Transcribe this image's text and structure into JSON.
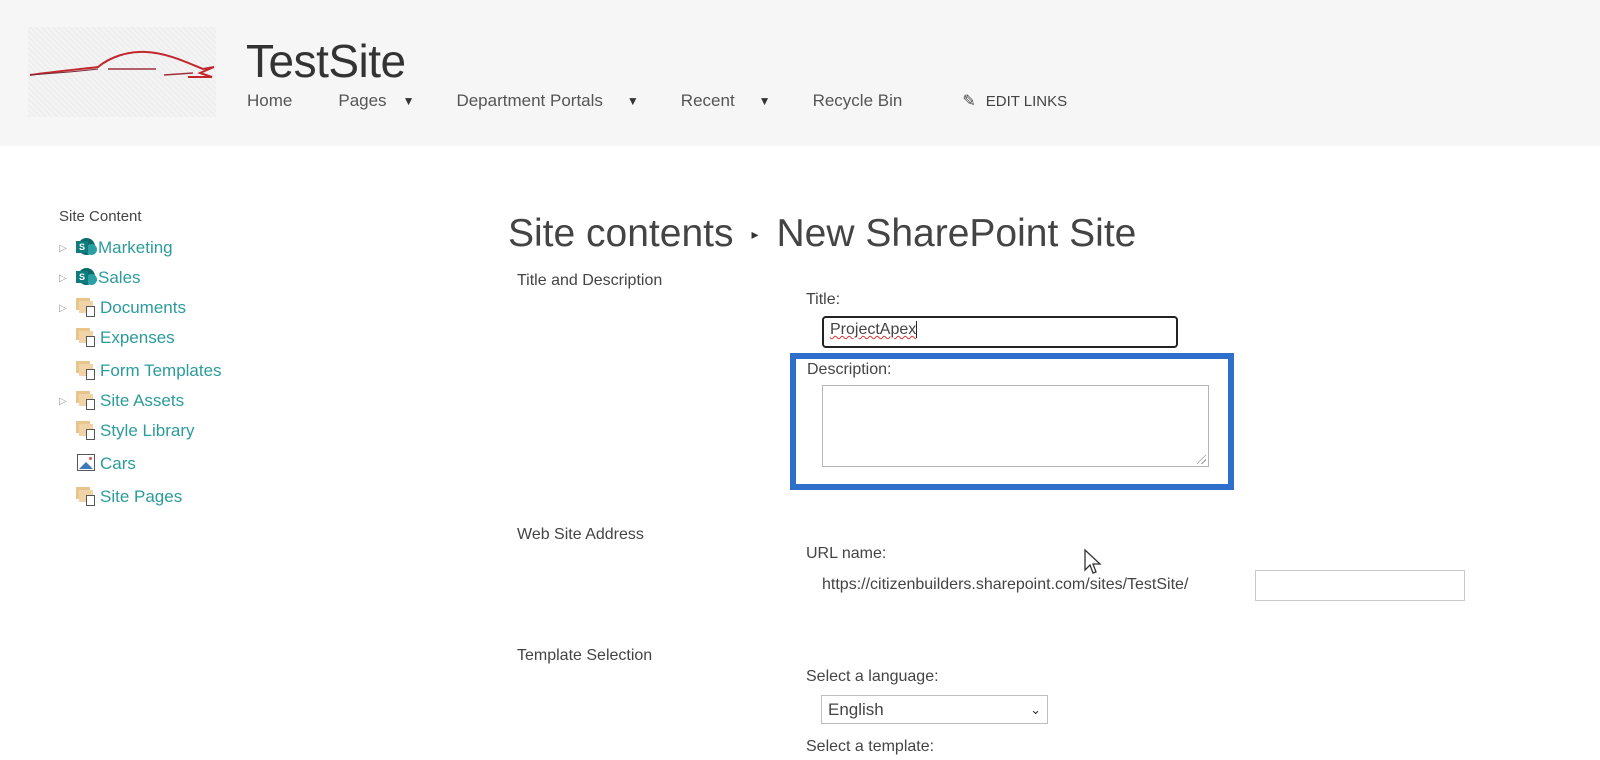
{
  "header": {
    "site_title": "TestSite",
    "nav": [
      {
        "label": "Home",
        "has_dropdown": false
      },
      {
        "label": "Pages",
        "has_dropdown": true
      },
      {
        "label": "Department Portals",
        "has_dropdown": true
      },
      {
        "label": "Recent",
        "has_dropdown": true
      },
      {
        "label": "Recycle Bin",
        "has_dropdown": false
      }
    ],
    "edit_links": "EDIT LINKS",
    "caret_glyph": "▼",
    "pencil_glyph": "✎"
  },
  "sidebar": {
    "heading": "Site Content",
    "items": [
      {
        "label": "Marketing",
        "icon": "sharepoint-site-icon",
        "expandable": true
      },
      {
        "label": "Sales",
        "icon": "sharepoint-site-icon",
        "expandable": true
      },
      {
        "label": "Documents",
        "icon": "document-library-icon",
        "expandable": true
      },
      {
        "label": "Expenses",
        "icon": "document-library-icon",
        "expandable": false
      },
      {
        "label": "Form Templates",
        "icon": "document-library-icon",
        "expandable": false
      },
      {
        "label": "Site Assets",
        "icon": "document-library-icon",
        "expandable": true
      },
      {
        "label": "Style Library",
        "icon": "document-library-icon",
        "expandable": false
      },
      {
        "label": "Cars",
        "icon": "picture-library-icon",
        "expandable": false
      },
      {
        "label": "Site Pages",
        "icon": "document-library-icon",
        "expandable": false
      }
    ],
    "expander_glyph": "▷"
  },
  "breadcrumb": {
    "parent": "Site contents",
    "separator": "▸",
    "current": "New SharePoint Site"
  },
  "form": {
    "title_section": "Title and Description",
    "title_label": "Title:",
    "title_value": "ProjectApex",
    "description_label": "Description:",
    "description_value": "",
    "address_section": "Web Site Address",
    "url_label": "URL name:",
    "url_prefix": "https://citizenbuilders.sharepoint.com/sites/TestSite/",
    "url_value": "",
    "template_section": "Template Selection",
    "language_label": "Select a language:",
    "language_value": "English",
    "template_label": "Select a template:"
  },
  "colors": {
    "highlight": "#2f6fcc",
    "link_teal": "#2c9b9b",
    "header_bg": "#f6f6f6"
  }
}
